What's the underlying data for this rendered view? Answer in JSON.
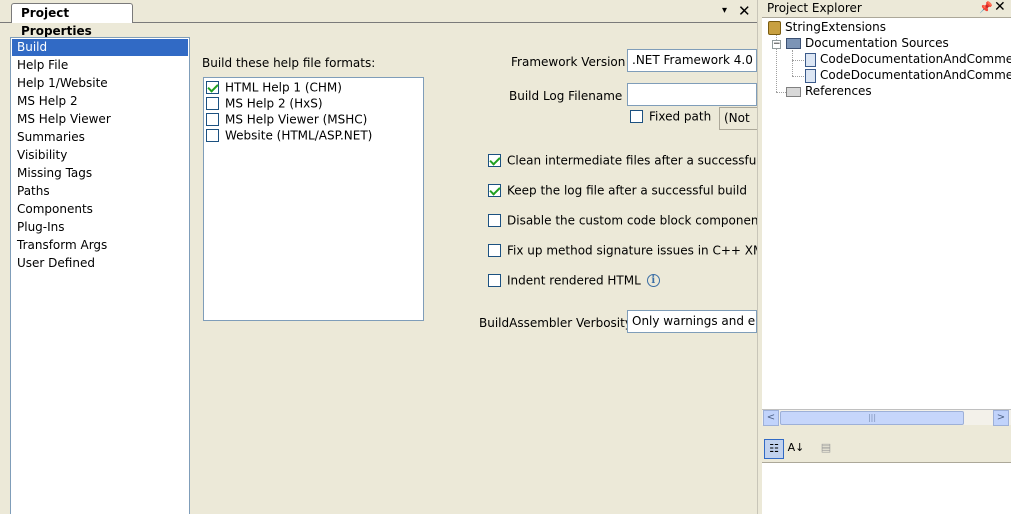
{
  "document": {
    "tab_title": "Project Properties",
    "dropdown_glyph": "▾",
    "close_glyph": "✕"
  },
  "categories": [
    {
      "label": "Build",
      "selected": true
    },
    {
      "label": "Help File"
    },
    {
      "label": "Help 1/Website"
    },
    {
      "label": "MS Help 2"
    },
    {
      "label": "MS Help Viewer"
    },
    {
      "label": "Summaries"
    },
    {
      "label": "Visibility"
    },
    {
      "label": "Missing Tags"
    },
    {
      "label": "Paths"
    },
    {
      "label": "Components"
    },
    {
      "label": "Plug-Ins"
    },
    {
      "label": "Transform Args"
    },
    {
      "label": "User Defined"
    }
  ],
  "build": {
    "formats_label": "Build these help file formats:",
    "formats": [
      {
        "label": "HTML Help 1 (CHM)",
        "checked": true
      },
      {
        "label": "MS Help 2 (HxS)",
        "checked": false
      },
      {
        "label": "MS Help Viewer (MSHC)",
        "checked": false
      },
      {
        "label": "Website (HTML/ASP.NET)",
        "checked": false
      }
    ],
    "framework_label": "Framework Version",
    "framework_value": ".NET Framework 4.0",
    "log_label": "Build Log Filename",
    "log_value": "",
    "fixed_path_label": "Fixed path",
    "fixed_path_checked": false,
    "fixed_path_value": "(Not",
    "options": [
      {
        "label": "Clean intermediate files after a successful bu",
        "checked": true
      },
      {
        "label": "Keep the log file after a successful build",
        "checked": true
      },
      {
        "label": "Disable the custom code block component",
        "checked": false
      },
      {
        "label": "Fix up method signature issues in C++ XML",
        "checked": false
      },
      {
        "label": "Indent rendered HTML",
        "checked": false
      }
    ],
    "info_glyph": "i",
    "verbosity_label": "BuildAssembler Verbosity",
    "verbosity_value": "Only warnings and er"
  },
  "explorer": {
    "title": "Project Explorer",
    "pin_glyph": "📌",
    "close_glyph": "✕",
    "tree": {
      "project": "StringExtensions",
      "doc_sources": "Documentation Sources",
      "files": [
        "CodeDocumentationAndComments",
        "CodeDocumentationAndComments"
      ],
      "references": "References"
    },
    "scroll_left": "<",
    "scroll_right": ">",
    "thumb_grip": "|||"
  },
  "properties_toolbar": {
    "categorized_glyph": "☷",
    "alphabetical_glyph": "A↓",
    "pages_glyph": "▤"
  }
}
